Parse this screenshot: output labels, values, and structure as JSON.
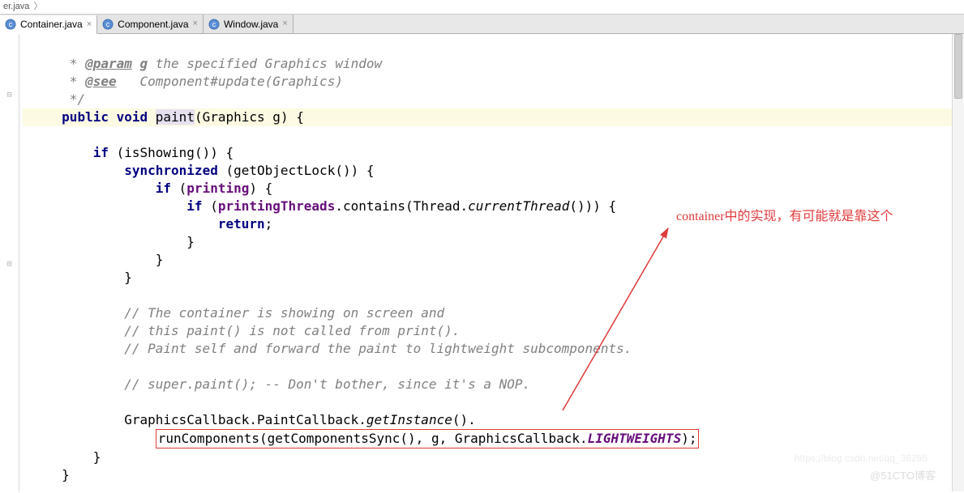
{
  "breadcrumb": {
    "label": "er.java",
    "sep": "〉"
  },
  "tabs": [
    {
      "label": "Container.java",
      "active": true
    },
    {
      "label": "Component.java",
      "active": false
    },
    {
      "label": "Window.java",
      "active": false
    }
  ],
  "close_glyph": "×",
  "gutter": {
    "fold_open": "⊟",
    "fold_closed": "⊕"
  },
  "code": {
    "doc_param_tag": "@param",
    "doc_param_name": "g",
    "doc_param_text": "the specified Graphics window",
    "doc_see_tag": "@see",
    "doc_see_text": "Component#update(Graphics)",
    "kw_public": "public",
    "kw_void": "void",
    "method_name": "paint",
    "param_type": "Graphics",
    "param_name": "g",
    "kw_if": "if",
    "call_isShowing": "isShowing",
    "kw_synchronized": "synchronized",
    "call_getObjectLock": "getObjectLock",
    "field_printing": "printing",
    "field_printingThreads": "printingThreads",
    "call_contains": "contains",
    "type_Thread": "Thread",
    "call_currentThread": "currentThread",
    "kw_return": "return",
    "comment1": "// The container is showing on screen and",
    "comment2": "// this paint() is not called from print().",
    "comment3": "// Paint self and forward the paint to lightweight subcomponents.",
    "comment4": "// super.paint(); -- Don't bother, since it's a NOP.",
    "type_GraphicsCallback": "GraphicsCallback",
    "call_PaintCallback": "PaintCallback",
    "call_getInstance": "getInstance",
    "call_runComponents": "runComponents",
    "call_getComponentsSync": "getComponentsSync",
    "arg_g": "g",
    "const_LIGHTWEIGHTS": "LIGHTWEIGHTS"
  },
  "annotation": {
    "text": "container中的实现，有可能就是靠这个",
    "color": "#e03a3a"
  },
  "watermark_top": "@51CTO博客",
  "watermark_bottom": "https://blog.csdn.net/qq_36285"
}
